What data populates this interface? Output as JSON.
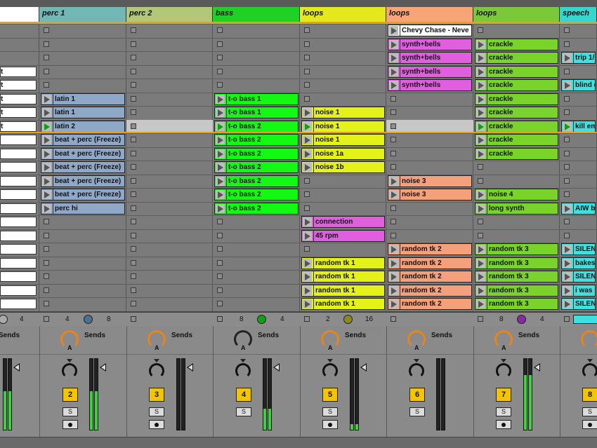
{
  "colors": {
    "perc1": "#73b6b6",
    "perc2": "#b3c77a",
    "bass": "#1fd124",
    "loops_yellow": "#e5e81b",
    "loops_orange": "#f7a478",
    "loops_green": "#7bc93a",
    "speech": "#35d6d0",
    "clip_blue": "#8fa8c8",
    "clip_green": "#14f914",
    "clip_yellow": "#e5f21a",
    "clip_magenta": "#e05fdf",
    "clip_salmon": "#f4a07a",
    "clip_lime": "#7ad32a",
    "clip_cyan": "#3ee0e0",
    "accent": "#e8a020",
    "track_number": "#f5c400"
  },
  "tracks": [
    {
      "name": "",
      "number": ""
    },
    {
      "name": "perc 1",
      "number": "2"
    },
    {
      "name": "perc 2",
      "number": "3"
    },
    {
      "name": "bass",
      "number": "4"
    },
    {
      "name": "loops",
      "number": "5"
    },
    {
      "name": "loops",
      "number": "6"
    },
    {
      "name": "loops",
      "number": "7"
    },
    {
      "name": "speech",
      "number": "8"
    }
  ],
  "scene_labels": [
    "",
    "",
    "",
    "t",
    "t",
    "t",
    "t",
    "t",
    "",
    "",
    "",
    "",
    "",
    "",
    "",
    "",
    "",
    "",
    "",
    "",
    ""
  ],
  "clips": {
    "perc1": [
      "latin 1",
      "latin 1",
      "latin 2",
      "beat + perc (Freeze)",
      "beat + perc (Freeze)",
      "beat + perc (Freeze)",
      "beat + perc (Freeze)",
      "beat + perc (Freeze)",
      "perc hi"
    ],
    "bass": [
      "t-o bass 1",
      "t-o bass 1",
      "t-o bass 2",
      "t-o bass 2",
      "t-o bass 2",
      "t-o bass 2",
      "t-o bass 2",
      "t-o bass 2",
      "t-o bass 2"
    ],
    "loops_yellow": [
      "noise 1",
      "noise 1",
      "noise 1",
      "noise 1a",
      "noise 1b",
      "connection",
      "45 rpm",
      "random tk 1",
      "random tk 1",
      "random tk 1",
      "random tk 1"
    ],
    "loops_orange": [
      "Chevy Chase - Neve",
      "synth+bells",
      "synth+bells",
      "synth+bells",
      "synth+bells",
      "noise 3",
      "noise 3",
      "random tk 2",
      "random tk 2",
      "random tk 2",
      "random tk 2",
      "random tk 2",
      "random tk 2"
    ],
    "loops_green": [
      "crackle",
      "crackle",
      "crackle",
      "crackle",
      "crackle",
      "crackle",
      "crackle",
      "crackle",
      "crackle",
      "noise 4",
      "long synth",
      "random tk 3",
      "random tk 3",
      "random tk 3",
      "random tk 3",
      "random tk 3"
    ],
    "speech": [
      "trip 1/1",
      "blind d",
      "kill em",
      "AIW bl",
      "SILENT",
      "bakesa",
      "SILENT",
      "i was b",
      "SILENT"
    ]
  },
  "status": {
    "c0_right": "4",
    "perc1_left": "4",
    "perc1_right": "8",
    "bass_left": "8",
    "bass_right": "4",
    "loops1_left": "2",
    "loops1_right": "16",
    "loops3_left": "8",
    "loops3_right": "4"
  },
  "mixer": {
    "sends_label": "Sends",
    "send_a": "A",
    "solo": "S"
  }
}
